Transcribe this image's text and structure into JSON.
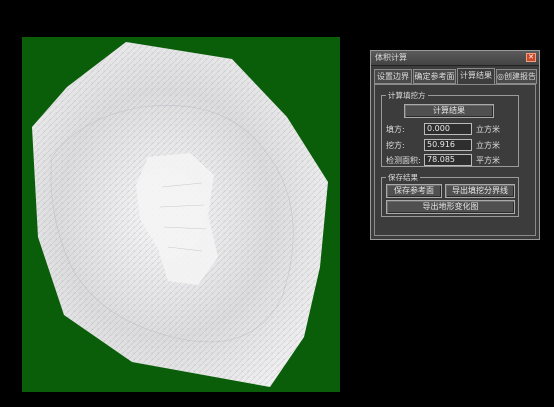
{
  "viewport": {
    "background": "#0a5e0a",
    "surface_color": "#ececec"
  },
  "dialog": {
    "title": "体积计算",
    "close_icon": "close-icon",
    "tabs": [
      {
        "label": "设置边界",
        "active": false
      },
      {
        "label": "确定参考面",
        "active": false
      },
      {
        "label": "计算结果",
        "active": true
      },
      {
        "label": "创建报告",
        "active": false
      }
    ],
    "report_tab_icon": "circle-icon",
    "fill_cut": {
      "group_title": "计算填挖方",
      "calc_button": "计算结果",
      "fill_label": "填方:",
      "fill_value": "0.000",
      "fill_unit": "立方米",
      "cut_label": "挖方:",
      "cut_value": "50.916",
      "cut_unit": "立方米",
      "area_label": "检测面积:",
      "area_value": "78.085",
      "area_unit": "平方米"
    },
    "save": {
      "group_title": "保存结果",
      "save_ref_button": "保存参考面",
      "export_line_button": "导出填挖分界线",
      "export_terrain_button": "导出地形变化图"
    }
  }
}
